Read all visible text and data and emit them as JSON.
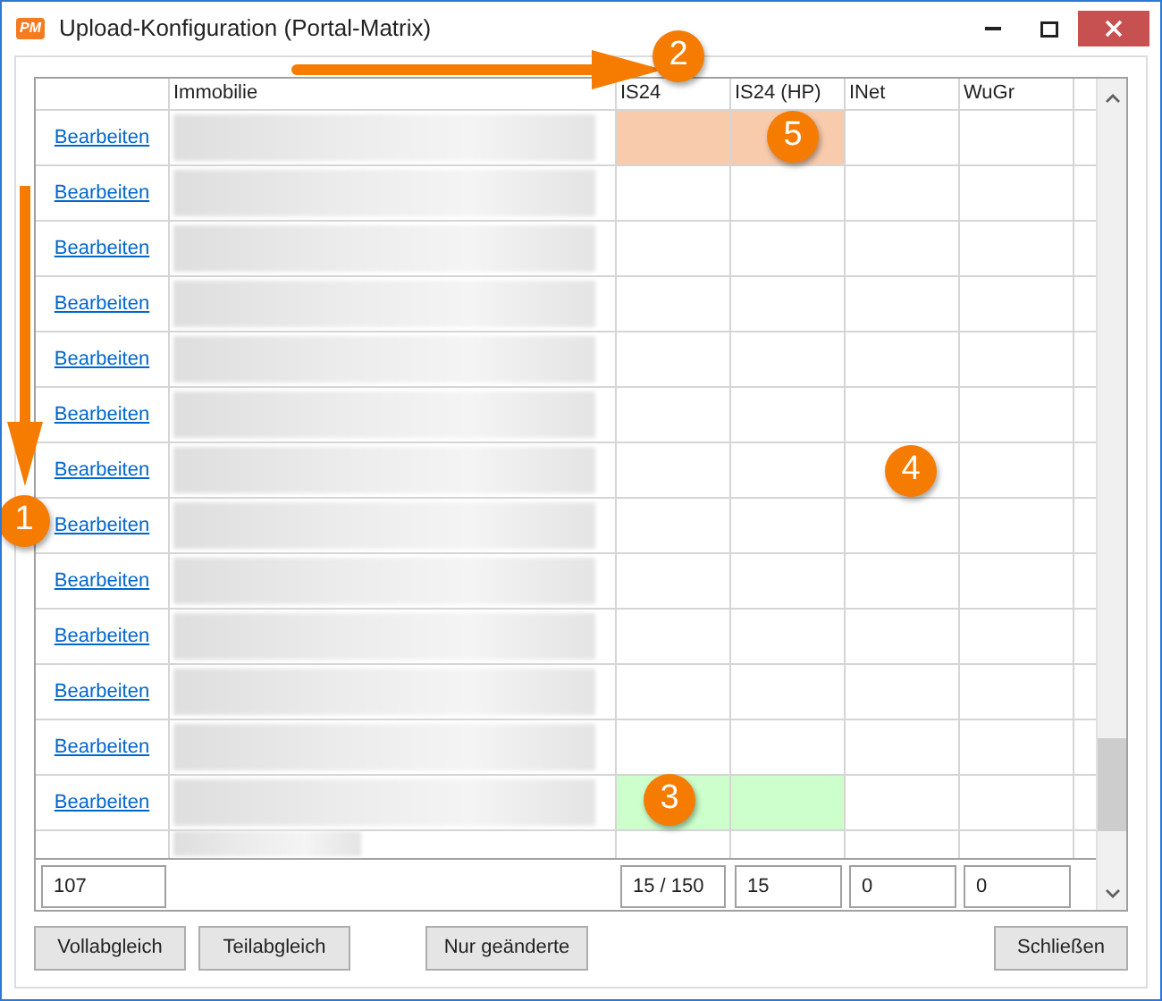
{
  "window": {
    "logo": "PM",
    "title": "Upload-Konfiguration (Portal-Matrix)"
  },
  "table": {
    "columns": [
      "Immobilie",
      "IS24",
      "IS24 (HP)",
      "INet",
      "WuGr"
    ],
    "rows": [
      {
        "link": "Bearbeiten",
        "cells": [
          {
            "color": "#f8cbad"
          },
          {
            "color": "#f8cbad"
          },
          {
            "color": "#ffffff"
          },
          {
            "color": "#ffffff"
          }
        ]
      },
      {
        "link": "Bearbeiten",
        "cells": [
          {
            "color": "#ffffff"
          },
          {
            "color": "#ffffff"
          },
          {
            "color": "#ffffff"
          },
          {
            "color": "#ffffff"
          }
        ]
      },
      {
        "link": "Bearbeiten",
        "cells": [
          {
            "color": "#ffffff"
          },
          {
            "color": "#ffffff"
          },
          {
            "color": "#ffffff"
          },
          {
            "color": "#ffffff"
          }
        ]
      },
      {
        "link": "Bearbeiten",
        "cells": [
          {
            "color": "#ffffff"
          },
          {
            "color": "#ffffff"
          },
          {
            "color": "#ffffff"
          },
          {
            "color": "#ffffff"
          }
        ]
      },
      {
        "link": "Bearbeiten",
        "cells": [
          {
            "color": "#ffffff"
          },
          {
            "color": "#ffffff"
          },
          {
            "color": "#ffffff"
          },
          {
            "color": "#ffffff"
          }
        ]
      },
      {
        "link": "Bearbeiten",
        "cells": [
          {
            "color": "#ffffff"
          },
          {
            "color": "#ffffff"
          },
          {
            "color": "#ffffff"
          },
          {
            "color": "#ffffff"
          }
        ]
      },
      {
        "link": "Bearbeiten",
        "cells": [
          {
            "color": "#ffffff"
          },
          {
            "color": "#ffffff"
          },
          {
            "color": "#ffffff"
          },
          {
            "color": "#ffffff"
          }
        ]
      },
      {
        "link": "Bearbeiten",
        "cells": [
          {
            "color": "#ffffff"
          },
          {
            "color": "#ffffff"
          },
          {
            "color": "#ffffff"
          },
          {
            "color": "#ffffff"
          }
        ]
      },
      {
        "link": "Bearbeiten",
        "cells": [
          {
            "color": "#ffffff"
          },
          {
            "color": "#ffffff"
          },
          {
            "color": "#ffffff"
          },
          {
            "color": "#ffffff"
          }
        ]
      },
      {
        "link": "Bearbeiten",
        "cells": [
          {
            "color": "#ffffff"
          },
          {
            "color": "#ffffff"
          },
          {
            "color": "#ffffff"
          },
          {
            "color": "#ffffff"
          }
        ]
      },
      {
        "link": "Bearbeiten",
        "cells": [
          {
            "color": "#ffffff"
          },
          {
            "color": "#ffffff"
          },
          {
            "color": "#ffffff"
          },
          {
            "color": "#ffffff"
          }
        ]
      },
      {
        "link": "Bearbeiten",
        "cells": [
          {
            "color": "#ffffff"
          },
          {
            "color": "#ffffff"
          },
          {
            "color": "#ffffff"
          },
          {
            "color": "#ffffff"
          }
        ]
      },
      {
        "link": "Bearbeiten",
        "cells": [
          {
            "color": "#ccffcc"
          },
          {
            "color": "#ccffcc"
          },
          {
            "color": "#ffffff"
          },
          {
            "color": "#ffffff"
          }
        ]
      }
    ],
    "totals": [
      "107",
      "15 / 150",
      "15",
      "0",
      "0"
    ]
  },
  "buttons": [
    "Vollabgleich",
    "Teilabgleich",
    "Nur geänderte"
  ],
  "close_button": "Schließen",
  "annotations": [
    "1",
    "2",
    "3",
    "4",
    "5"
  ]
}
